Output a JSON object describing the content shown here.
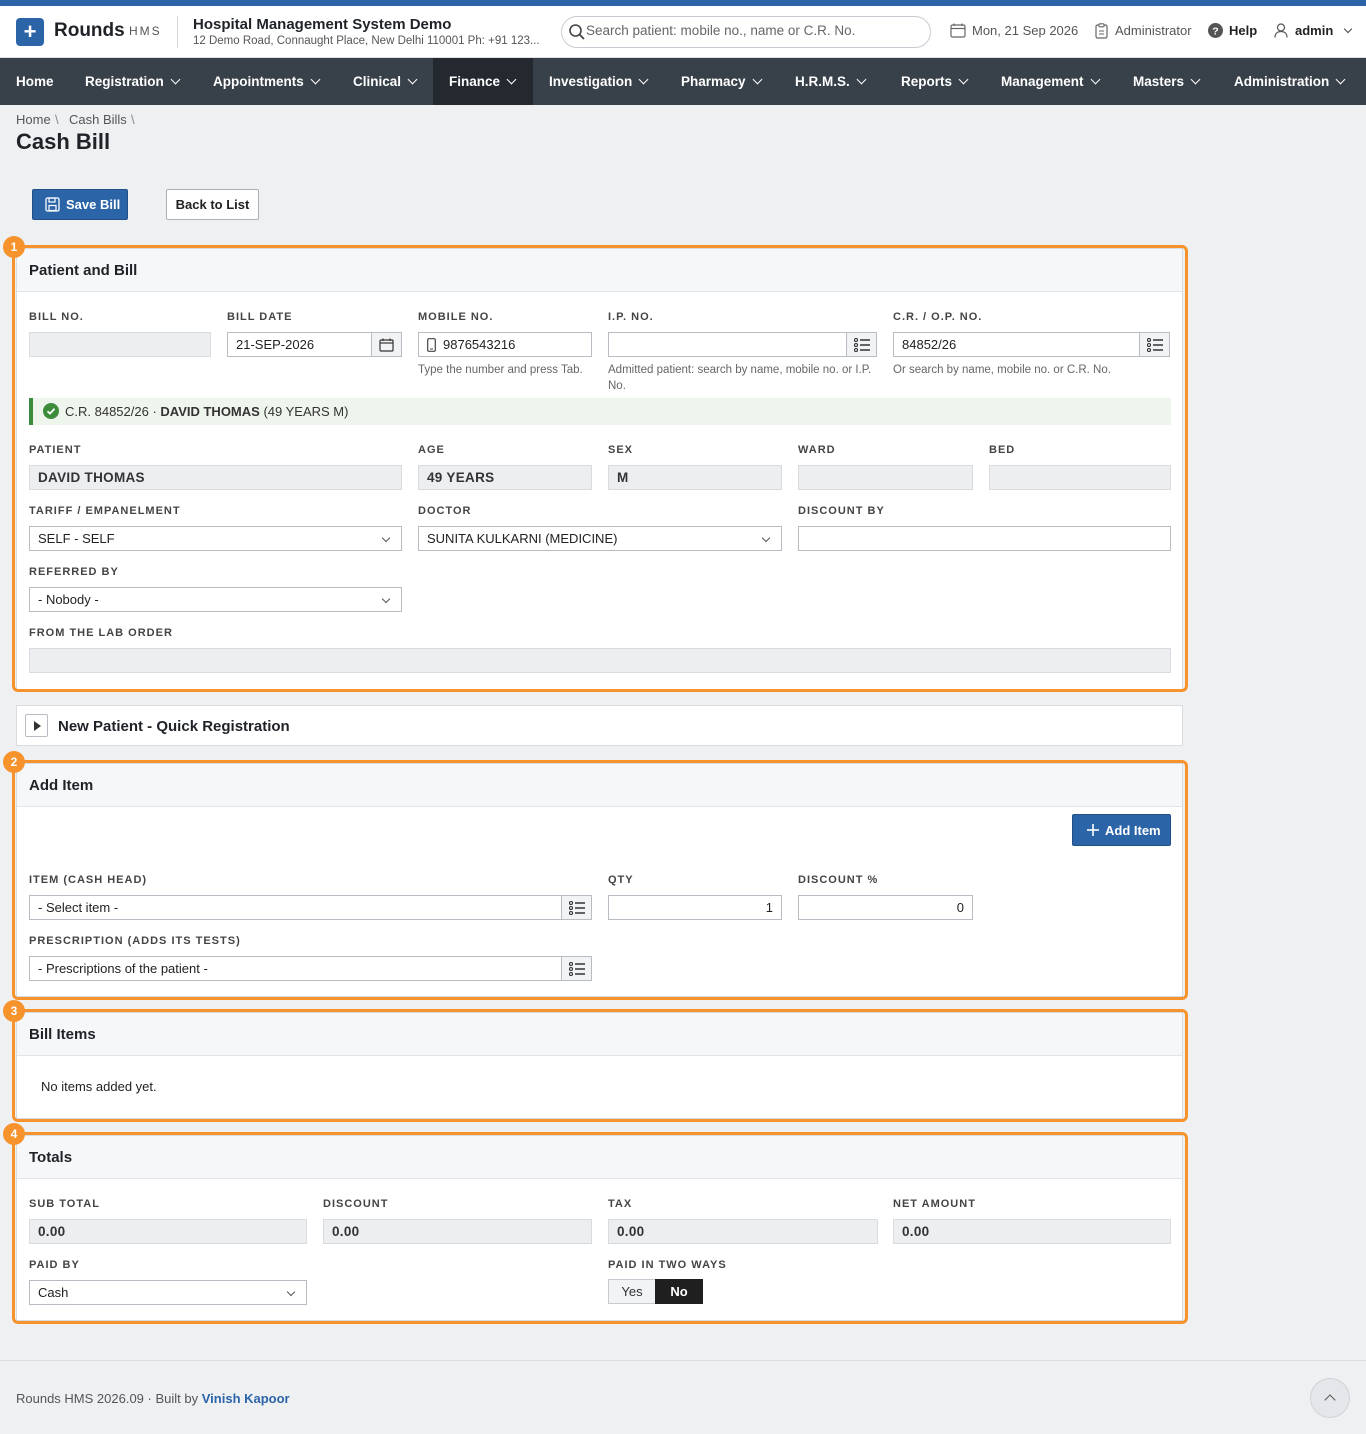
{
  "app": {
    "brand": "Rounds",
    "brand_sub": "HMS",
    "hospital_name": "Hospital Management System Demo",
    "hospital_address": "12 Demo Road, Connaught Place, New Delhi 110001 Ph: +91 123...",
    "search_placeholder": "Search patient: mobile no., name or C.R. No.",
    "date": "Mon, 21 Sep 2026",
    "role": "Administrator",
    "help": "Help",
    "user": "admin",
    "accent_color": "#2c64a8",
    "highlight_color": "#f7932d"
  },
  "nav": {
    "items": [
      "Home",
      "Registration",
      "Appointments",
      "Clinical",
      "Finance",
      "Investigation",
      "Pharmacy",
      "H.R.M.S.",
      "Reports",
      "Management",
      "Masters",
      "Administration"
    ],
    "active": "Finance"
  },
  "breadcrumb": [
    "Home",
    "Cash Bills"
  ],
  "page_title": "Cash Bill",
  "actions": {
    "save": "Save Bill",
    "back": "Back to List"
  },
  "section1": {
    "badge": "1",
    "title": "Patient and Bill",
    "labels": {
      "bill_no": "BILL NO.",
      "bill_date": "BILL DATE",
      "mobile": "MOBILE NO.",
      "ip_no": "I.P. NO.",
      "cr_no": "C.R. / O.P. NO.",
      "patient": "PATIENT",
      "age": "AGE",
      "sex": "SEX",
      "ward": "WARD",
      "bed": "BED",
      "tariff": "TARIFF / EMPANELMENT",
      "doctor": "DOCTOR",
      "discount_by": "DISCOUNT BY",
      "referred_by": "REFERRED BY",
      "lab_order": "FROM THE LAB ORDER"
    },
    "values": {
      "bill_no": "",
      "bill_date": "21-SEP-2026",
      "mobile": "9876543216",
      "ip_no": "",
      "cr_no": "84852/26",
      "patient": "DAVID THOMAS",
      "age": "49 YEARS",
      "sex": "M",
      "ward": "",
      "bed": "",
      "tariff": "SELF - SELF",
      "doctor": "SUNITA KULKARNI (MEDICINE)",
      "discount_by": "",
      "referred_by": "- Nobody -",
      "lab_order": ""
    },
    "help": {
      "mobile": "Type the number and press Tab.",
      "ip_no": "Admitted patient: search by name, mobile no. or I.P. No.",
      "cr_no": "Or search by name, mobile no. or C.R. No."
    },
    "match": {
      "prefix": "C.R. 84852/26 · ",
      "name": "DAVID THOMAS",
      "suffix": " (49 YEARS M)"
    }
  },
  "quick_registration": {
    "title": "New Patient - Quick Registration"
  },
  "section2": {
    "badge": "2",
    "title": "Add Item",
    "add_button": "Add Item",
    "labels": {
      "item": "ITEM (CASH HEAD)",
      "qty": "QTY",
      "discount_pct": "DISCOUNT %",
      "prescription": "PRESCRIPTION (ADDS ITS TESTS)"
    },
    "values": {
      "item": "- Select item -",
      "qty": "1",
      "discount_pct": "0",
      "prescription": "- Prescriptions of the patient -"
    }
  },
  "section3": {
    "badge": "3",
    "title": "Bill Items",
    "empty": "No items added yet."
  },
  "section4": {
    "badge": "4",
    "title": "Totals",
    "labels": {
      "sub_total": "SUB TOTAL",
      "discount": "DISCOUNT",
      "tax": "TAX",
      "net_amount": "NET AMOUNT",
      "paid_by": "PAID BY",
      "paid_two_ways": "PAID IN TWO WAYS"
    },
    "values": {
      "sub_total": "0.00",
      "discount": "0.00",
      "tax": "0.00",
      "net_amount": "0.00",
      "paid_by": "Cash"
    },
    "two_ways": {
      "yes": "Yes",
      "no": "No",
      "selected": "No"
    }
  },
  "footer": {
    "version": "Rounds HMS 2026.09",
    "sep": " · ",
    "built_by": "Built by ",
    "author": "Vinish Kapoor"
  }
}
